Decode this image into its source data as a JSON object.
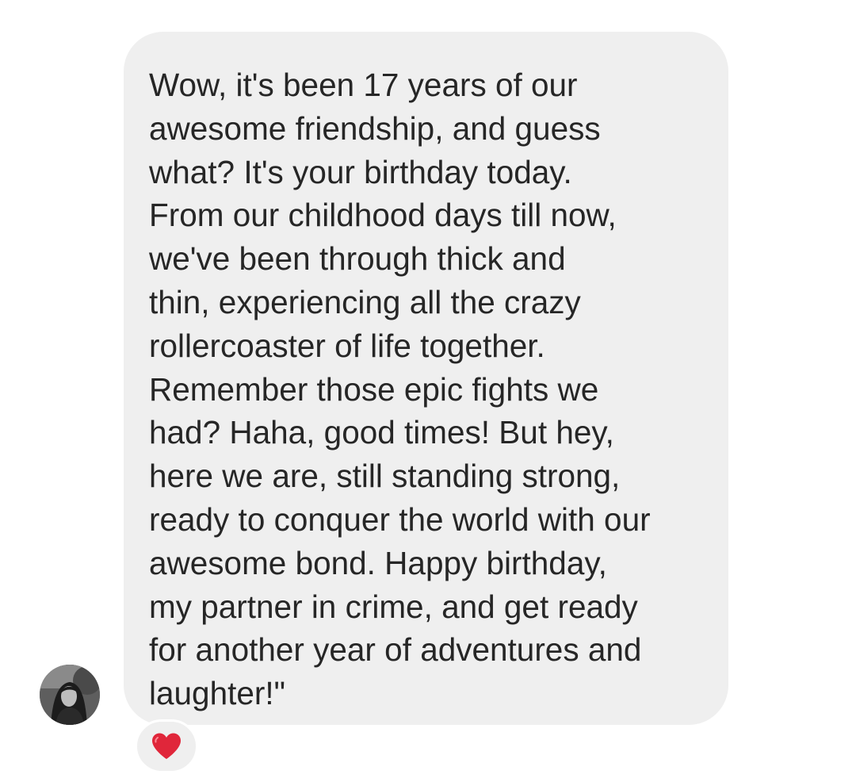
{
  "message": {
    "text": "Wow, it's been 17 years of our\nawesome friendship, and guess\nwhat? It's your birthday today.\nFrom our childhood days till now,\nwe've been through thick and\nthin, experiencing all the crazy\nrollercoaster of life together.\nRemember those epic fights we\nhad? Haha, good times! But hey,\nhere we are, still standing strong,\nready to conquer the world with our\nawesome bond. Happy birthday,\nmy partner in crime, and get ready\nfor another year of adventures and\nlaughter!\""
  },
  "sender": {
    "avatar_icon": "profile-photo"
  },
  "reaction": {
    "icon": "red-heart-icon",
    "color": "#e0263a"
  },
  "colors": {
    "bubble": "#efefef",
    "text": "#262626",
    "background": "#ffffff"
  }
}
